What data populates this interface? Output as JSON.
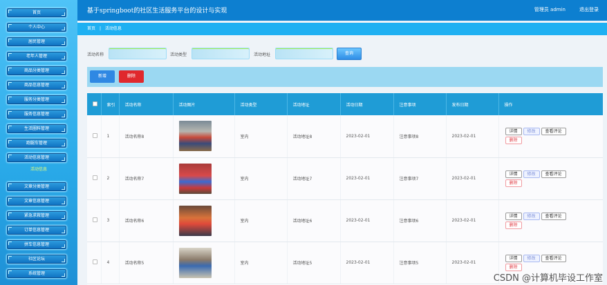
{
  "app": {
    "title": "基于springboot的社区生活服务平台的设计与实现",
    "user": "管理员 admin",
    "logout": "退出登录"
  },
  "sidebar": {
    "items": [
      {
        "label": "首页"
      },
      {
        "label": "个人中心"
      },
      {
        "label": "居民管理"
      },
      {
        "label": "老年人管理"
      },
      {
        "label": "商品分类管理"
      },
      {
        "label": "商品信息管理"
      },
      {
        "label": "服务分类管理"
      },
      {
        "label": "服务信息管理"
      },
      {
        "label": "生活圈料管理"
      },
      {
        "label": "跑腿车管理"
      },
      {
        "label": "活动信息管理"
      },
      {
        "label": "文章分类管理"
      },
      {
        "label": "文章信息管理"
      },
      {
        "label": "紧急求救管理"
      },
      {
        "label": "订单信息管理"
      },
      {
        "label": "拼车信息管理"
      },
      {
        "label": "社区论坛"
      },
      {
        "label": "系统管理"
      }
    ],
    "sub_active": "活动信息"
  },
  "breadcrumb": {
    "home": "首页",
    "sep": "|",
    "current": "活动信息"
  },
  "search": {
    "name_label": "活动名称",
    "type_label": "活动类型",
    "addr_label": "活动地址",
    "button": "查询"
  },
  "toolbar": {
    "add": "新增",
    "delete": "删除"
  },
  "table": {
    "headers": [
      "索引",
      "活动名称",
      "活动图片",
      "活动类型",
      "活动地址",
      "活动日期",
      "注意事项",
      "发布日期",
      "操作"
    ],
    "rows": [
      {
        "idx": "1",
        "name": "活动名称8",
        "type": "室内",
        "addr": "活动地址8",
        "date": "2023-02-01",
        "note": "注意事项8",
        "pub": "2023-02-01"
      },
      {
        "idx": "2",
        "name": "活动名称7",
        "type": "室内",
        "addr": "活动地址7",
        "date": "2023-02-01",
        "note": "注意事项7",
        "pub": "2023-02-01"
      },
      {
        "idx": "3",
        "name": "活动名称6",
        "type": "室内",
        "addr": "活动地址6",
        "date": "2023-02-01",
        "note": "注意事项6",
        "pub": "2023-02-01"
      },
      {
        "idx": "4",
        "name": "活动名称5",
        "type": "室内",
        "addr": "活动地址5",
        "date": "2023-02-01",
        "note": "注意事项5",
        "pub": "2023-02-01"
      }
    ],
    "ops": {
      "detail": "详情",
      "edit": "修改",
      "comments": "查看评论",
      "delete": "删除"
    }
  },
  "watermark": "CSDN @计算机毕设工作室",
  "colors": {
    "header": "#0d7fd0",
    "accent": "#1f9cd6",
    "danger": "#e0282d"
  }
}
